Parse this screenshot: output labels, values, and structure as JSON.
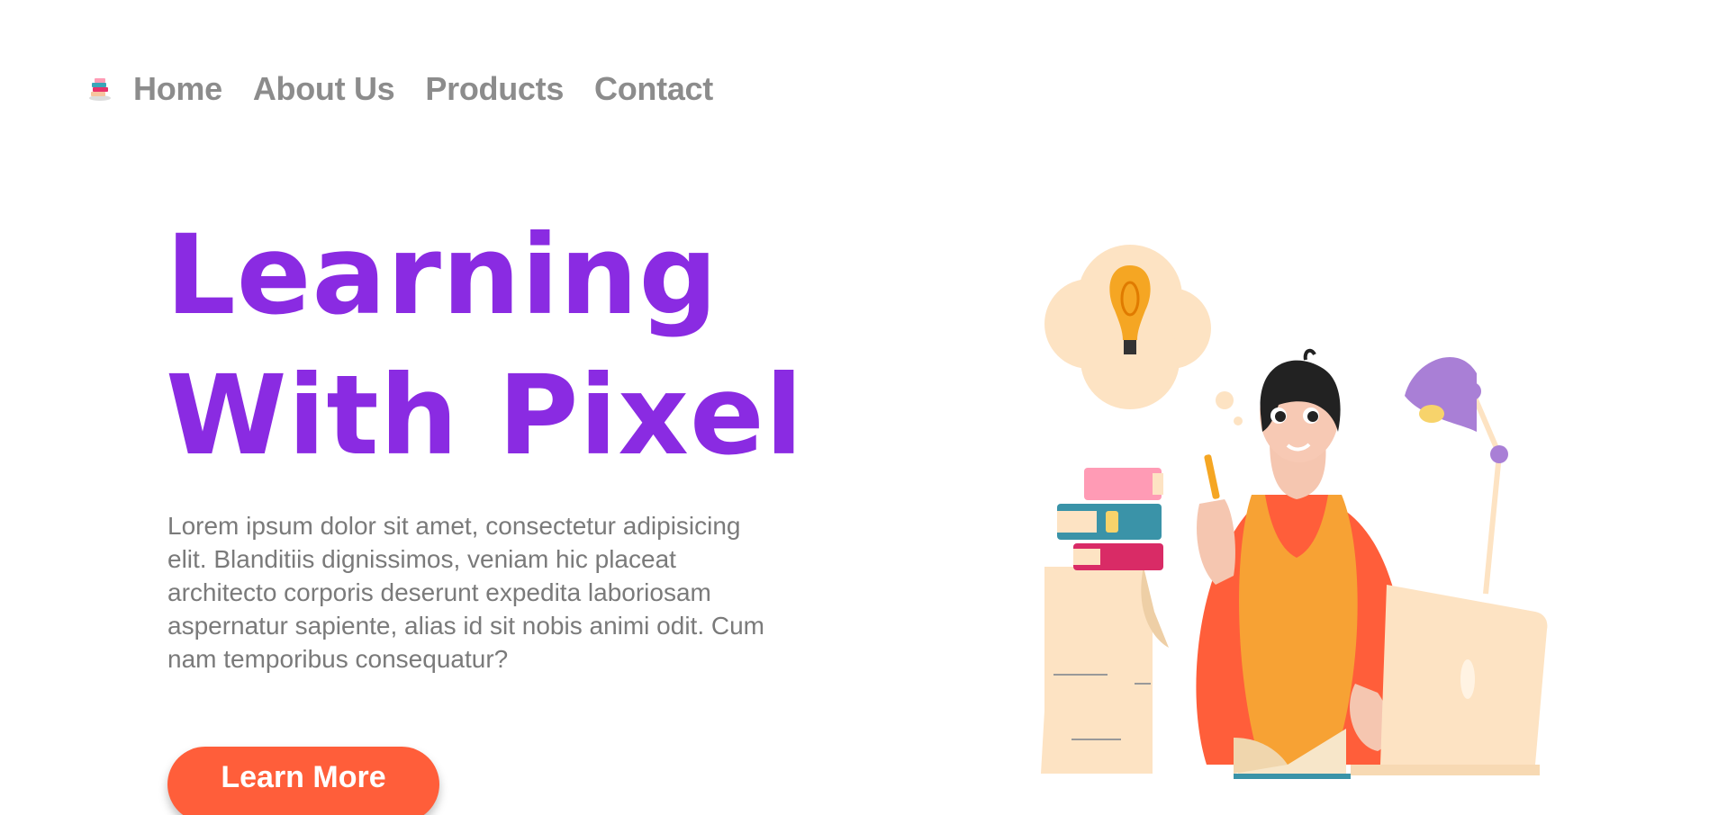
{
  "nav": {
    "logo_icon": "books-logo-icon",
    "items": [
      {
        "label": "Home"
      },
      {
        "label": "About Us"
      },
      {
        "label": "Products"
      },
      {
        "label": "Contact"
      }
    ]
  },
  "hero": {
    "title_line1": "Learning",
    "title_line2": "With Pixel",
    "description": "Lorem ipsum dolor sit amet, consectetur adipisicing elit. Blanditiis dignissimos, veniam hic placeat architecto corporis deserunt expedita laboriosam aspernatur sapiente, alias id sit nobis animi odit. Cum nam temporibus consequatur?",
    "button_label": "Learn More"
  },
  "illustration": {
    "icon": "student-studying-illustration",
    "colors": {
      "title": "#8a2be2",
      "button": "#ff5e3a",
      "nav_text": "#8c8c8c",
      "body_text": "#7a7a7a"
    }
  }
}
